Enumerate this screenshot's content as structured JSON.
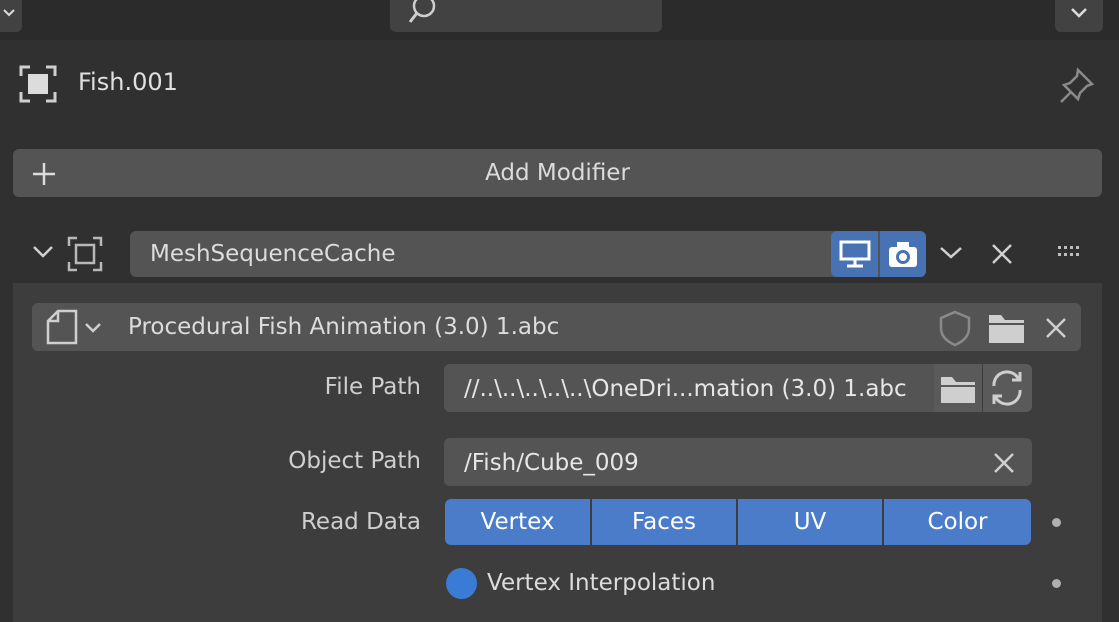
{
  "object": {
    "name": "Fish.001"
  },
  "add_modifier": {
    "label": "Add Modifier"
  },
  "modifier": {
    "name": "MeshSequenceCache"
  },
  "cache_file": {
    "name": "Procedural Fish Animation (3.0) 1.abc"
  },
  "file_path": {
    "label": "File Path",
    "value": "//..\\..\\..\\..\\..\\OneDri...mation (3.0) 1.abc"
  },
  "object_path": {
    "label": "Object Path",
    "value": "/Fish/Cube_009"
  },
  "read_data": {
    "label": "Read Data",
    "options": [
      "Vertex",
      "Faces",
      "UV",
      "Color"
    ]
  },
  "vertex_interpolation": {
    "label": "Vertex Interpolation",
    "checked": true
  },
  "colors": {
    "accent": "#4772b3",
    "segment": "#4b7cc9",
    "panel": "#3d3d3d",
    "field": "#545454",
    "bg": "#303030"
  },
  "icons": [
    "chevron-down-icon",
    "search-icon",
    "object-data-icon",
    "pin-icon",
    "plus-icon",
    "expand-chevron-icon",
    "modifier-type-icon",
    "monitor-icon",
    "camera-icon",
    "close-icon",
    "drag-handle-icon",
    "file-icon",
    "shield-icon",
    "folder-icon",
    "refresh-icon"
  ]
}
